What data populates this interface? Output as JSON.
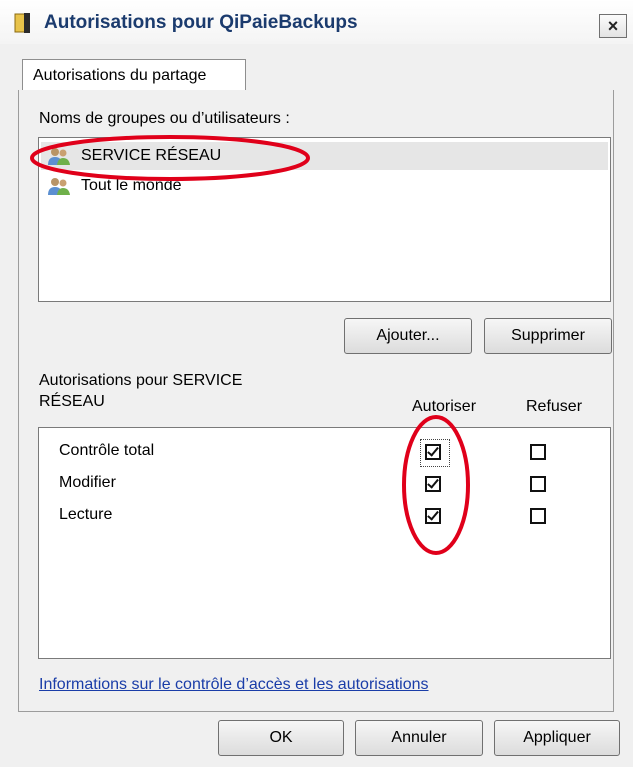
{
  "window": {
    "title": "Autorisations pour QiPaieBackups",
    "close_glyph": "×"
  },
  "tabs": [
    {
      "label": "Autorisations du partage",
      "selected": true
    }
  ],
  "users_section": {
    "label": "Noms de groupes ou d’utilisateurs :",
    "items": [
      {
        "label": "SERVICE RÉSEAU",
        "icon": "user-group-icon",
        "selected": true
      },
      {
        "label": "Tout le monde",
        "icon": "user-group-icon",
        "selected": false
      }
    ]
  },
  "buttons": {
    "add": "Ajouter...",
    "remove": "Supprimer",
    "ok": "OK",
    "cancel": "Annuler",
    "apply": "Appliquer"
  },
  "permissions_section": {
    "label_line1": "Autorisations pour SERVICE",
    "label_line2": "RÉSEAU",
    "col_allow": "Autoriser",
    "col_deny": "Refuser",
    "rows": [
      {
        "name": "Contrôle total",
        "allow": true,
        "deny": false
      },
      {
        "name": "Modifier",
        "allow": true,
        "deny": false
      },
      {
        "name": "Lecture",
        "allow": true,
        "deny": false
      }
    ]
  },
  "link": "Informations sur le contrôle d’accès et les autorisations",
  "colors": {
    "annotation": "#e0001a",
    "title_text": "#1b3b6e",
    "link": "#1a3da8"
  }
}
